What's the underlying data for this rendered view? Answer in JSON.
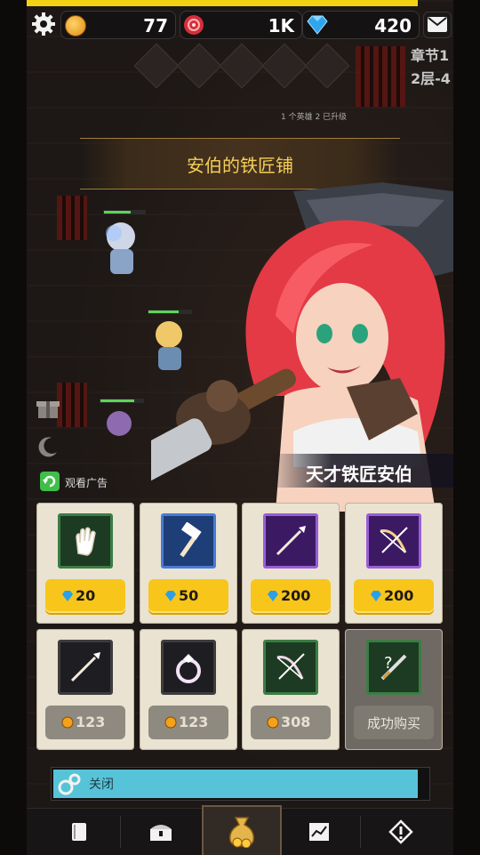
{
  "topbar": {
    "gold": "77",
    "orb": "1K",
    "gems": "420"
  },
  "map": {
    "chapter_line1": "章节1",
    "chapter_line2": "2层-4",
    "notice": "1 个英雄 2 已升级"
  },
  "shop": {
    "title": "安伯的铁匠铺",
    "npc_name": "天才铁匠安伯",
    "ad_label": "观看广告",
    "items": [
      {
        "icon": "glove-icon",
        "frame": "green",
        "currency": "gem",
        "price": "20"
      },
      {
        "icon": "hammer-icon",
        "frame": "blue",
        "currency": "gem",
        "price": "50"
      },
      {
        "icon": "spear-icon",
        "frame": "purple",
        "currency": "gem",
        "price": "200"
      },
      {
        "icon": "bow-icon",
        "frame": "purple",
        "currency": "gem",
        "price": "200"
      },
      {
        "icon": "spear-icon",
        "frame": "dark",
        "currency": "gold",
        "price": "123"
      },
      {
        "icon": "ring-icon",
        "frame": "dark",
        "currency": "gold",
        "price": "123"
      },
      {
        "icon": "bow-icon",
        "frame": "green",
        "currency": "gold",
        "price": "308"
      },
      {
        "icon": "question-sword-icon",
        "frame": "green",
        "currency": "none",
        "price": "成功购买"
      }
    ],
    "close_label": "关闭"
  },
  "nav": [
    "book-icon",
    "treasure-chest-icon",
    "gold-bag-icon",
    "map-icon",
    "warning-icon"
  ],
  "colors": {
    "gem_button": "#f8c51a",
    "gold_button": "#8f8a80",
    "title_gold": "#f5cf57",
    "close_bar": "#57c3d8"
  }
}
